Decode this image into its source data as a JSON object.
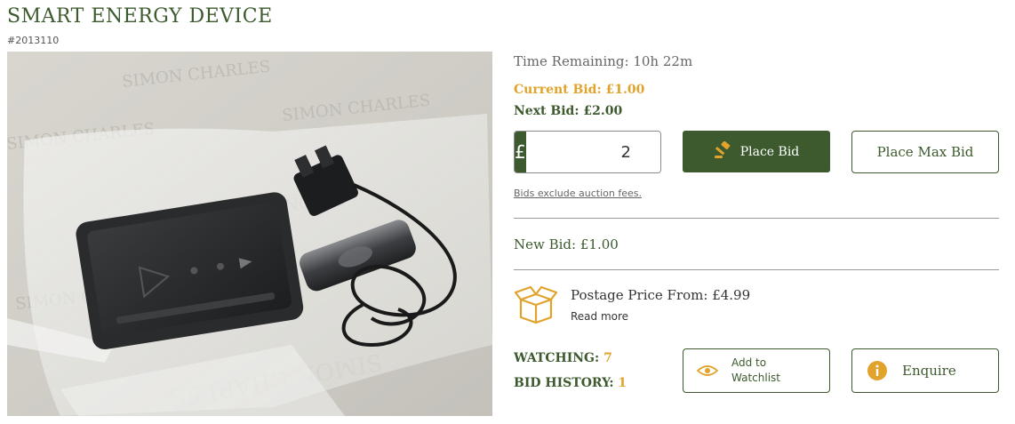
{
  "product": {
    "title": "SMART ENERGY DEVICE",
    "lot_id": "#2013110"
  },
  "bidding": {
    "time_remaining": "Time Remaining: 10h 22m",
    "current_bid": "Current Bid: £1.00",
    "next_bid": "Next Bid: £2.00",
    "currency_symbol": "£",
    "bid_amount": "2",
    "place_bid_label": "Place Bid",
    "place_max_bid_label": "Place Max Bid",
    "fees_note": "Bids exclude auction fees.",
    "new_bid": "New Bid: £1.00"
  },
  "postage": {
    "label": "Postage Price From: £4.99",
    "read_more": "Read more"
  },
  "stats": {
    "watching_label": "WATCHING:",
    "watching_count": "7",
    "history_label": "BID HISTORY:",
    "history_count": "1"
  },
  "actions": {
    "watchlist_label": "Add to Watchlist",
    "enquire_label": "Enquire"
  },
  "image": {
    "watermark": "SIMON CHARLES"
  },
  "icons": {
    "gavel": "gavel-icon",
    "box": "box-icon",
    "eye": "eye-icon",
    "info": "info-icon"
  },
  "colors": {
    "brand_green": "#3c5a2e",
    "accent_gold": "#e1a32b",
    "divider": "#9a9a9a"
  }
}
